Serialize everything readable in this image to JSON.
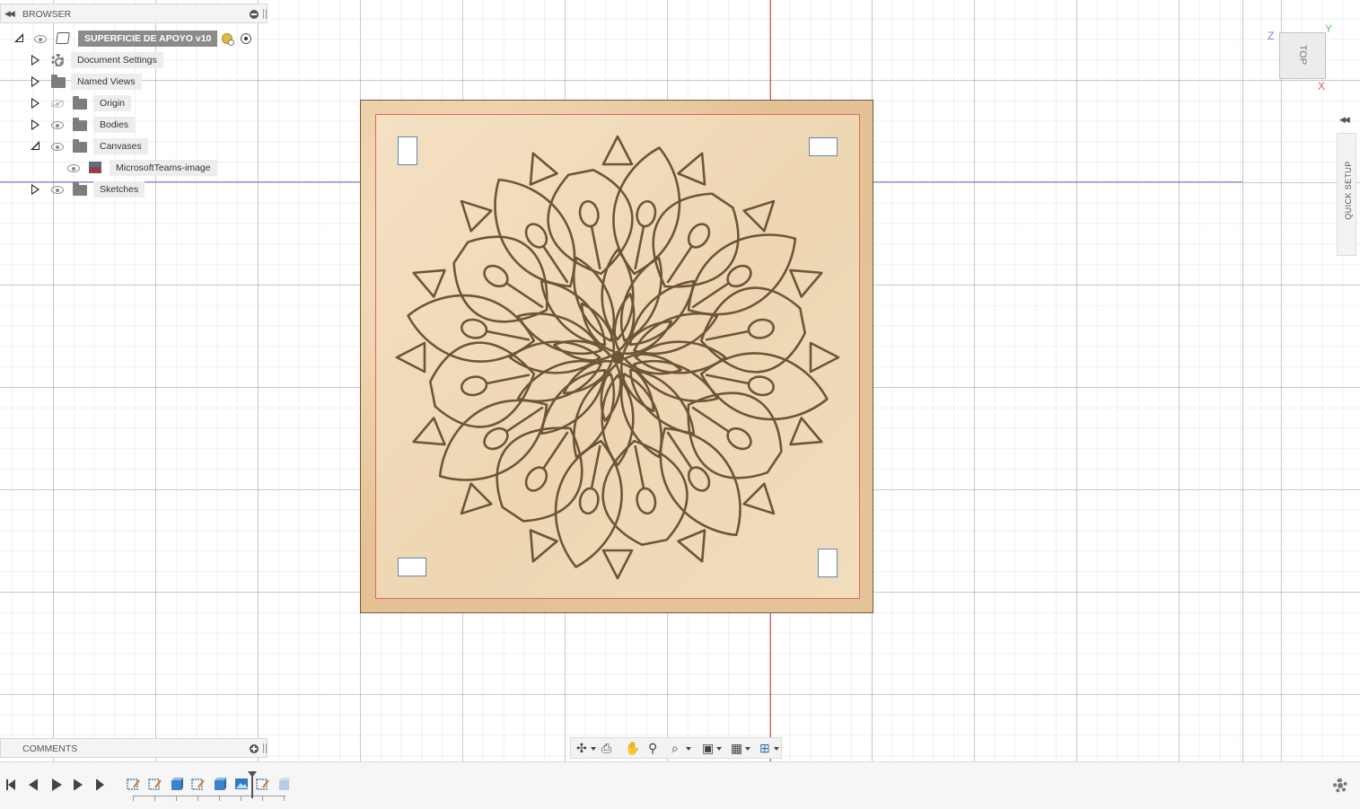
{
  "browser": {
    "title": "BROWSER",
    "root": {
      "label": "SUPERFICIE DE APOYO v10"
    },
    "items": [
      {
        "label": "Document Settings",
        "icon": "gear-icon",
        "expanded": false
      },
      {
        "label": "Named Views",
        "icon": "folder-icon",
        "expanded": false
      },
      {
        "label": "Origin",
        "icon": "folder-icon",
        "visible": false,
        "expanded": false
      },
      {
        "label": "Bodies",
        "icon": "folder-icon",
        "visible": true,
        "expanded": false
      },
      {
        "label": "Canvases",
        "icon": "folder-icon",
        "visible": true,
        "expanded": true
      },
      {
        "label": "MicrosoftTeams-image",
        "icon": "canvas-image-icon",
        "visible": true
      },
      {
        "label": "Sketches",
        "icon": "folder-icon",
        "visible": true,
        "expanded": false
      }
    ]
  },
  "comments": {
    "title": "COMMENTS"
  },
  "viewcube": {
    "face": "TOP",
    "axis_z": "Z",
    "axis_y": "Y",
    "axis_x": "X"
  },
  "quick_setup": {
    "label": "QUICK SETUP"
  },
  "nav_toolbar": [
    "orbit-icon",
    "look-at-icon",
    "pan-icon",
    "zoom-icon",
    "fit-icon",
    "display-settings-icon",
    "grid-icon",
    "viewports-icon"
  ],
  "timeline": {
    "features": [
      "sketch",
      "sketch",
      "extrude",
      "sketch",
      "extrude",
      "canvas",
      "sketch-current",
      "extrude-suppressed"
    ]
  },
  "colors": {
    "x_axis": "#e5595a",
    "y_axis": "#8c88e6",
    "root_bg": "#8b8b8b",
    "wood": "#e4c296",
    "cut_line": "#e0645a",
    "engrave": "#6d5638"
  }
}
